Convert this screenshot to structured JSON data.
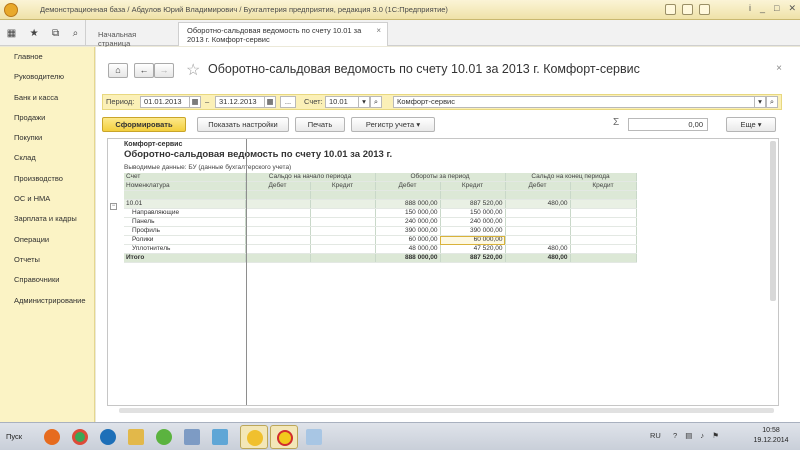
{
  "window": {
    "title": "Демонстрационная база / Абдулов Юрий Владимирович / Бухгалтерия предприятия, редакция 3.0 (1С:Предприятие)"
  },
  "tabs": {
    "home": "Начальная страница",
    "active": "Оборотно-сальдовая ведомость по счету 10.01 за 2013 г. Комфорт-сервис"
  },
  "sidebar": {
    "items": [
      {
        "label": "Главное"
      },
      {
        "label": "Руководителю"
      },
      {
        "label": "Банк и касса"
      },
      {
        "label": "Продажи"
      },
      {
        "label": "Покупки"
      },
      {
        "label": "Склад"
      },
      {
        "label": "Производство"
      },
      {
        "label": "ОС и НМА"
      },
      {
        "label": "Зарплата и кадры"
      },
      {
        "label": "Операции"
      },
      {
        "label": "Отчеты"
      },
      {
        "label": "Справочники"
      },
      {
        "label": "Администрирование"
      }
    ]
  },
  "header": {
    "title": "Оборотно-сальдовая ведомость по счету 10.01 за 2013 г. Комфорт-сервис",
    "nav_back": "←",
    "nav_forward": "→"
  },
  "filters": {
    "period_label": "Период:",
    "date_from": "01.01.2013",
    "dash": "–",
    "date_to": "31.12.2013",
    "choose_period": "...",
    "account_label": "Счет:",
    "account": "10.01",
    "organization": "Комфорт-сервис"
  },
  "toolbar": {
    "generate": "Сформировать",
    "show_settings": "Показать настройки",
    "print": "Печать",
    "account_register": "Регистр учета",
    "sum_value": "0,00",
    "more": "Еще"
  },
  "report": {
    "org": "Комфорт-сервис",
    "title": "Оборотно-сальдовая ведомость по счету 10.01 за 2013 г.",
    "source": "Выводимые данные:  БУ (данные бухгалтерского учета)",
    "col_account": "Счет",
    "col_nomenclature": "Номенклатура",
    "col_opening": "Сальдо на начало периода",
    "col_turnover": "Обороты за период",
    "col_closing": "Сальдо на конец периода",
    "col_debit": "Дебет",
    "col_credit": "Кредит",
    "account_row": {
      "name": "10.01",
      "turn_debit": "888 000,00",
      "turn_credit": "887 520,00",
      "close_debit": "480,00"
    },
    "rows": [
      {
        "name": "Направляющие",
        "turn_debit": "150 000,00",
        "turn_credit": "150 000,00",
        "close_debit": ""
      },
      {
        "name": "Панель",
        "turn_debit": "240 000,00",
        "turn_credit": "240 000,00",
        "close_debit": ""
      },
      {
        "name": "Профиль",
        "turn_debit": "390 000,00",
        "turn_credit": "390 000,00",
        "close_debit": ""
      },
      {
        "name": "Ролики",
        "turn_debit": "60 000,00",
        "turn_credit": "60 000,00",
        "close_debit": ""
      },
      {
        "name": "Уплотнитель",
        "turn_debit": "48 000,00",
        "turn_credit": "47 520,00",
        "close_debit": "480,00"
      }
    ],
    "total": {
      "name": "Итого",
      "turn_debit": "888 000,00",
      "turn_credit": "887 520,00",
      "close_debit": "480,00"
    }
  },
  "taskbar": {
    "start": "Пуск",
    "lang": "RU",
    "time": "10:58",
    "date": "19.12.2014"
  },
  "colors": {
    "sidebar_bg": "#fbf3c5",
    "primary_button": "#f3cf3e",
    "table_header": "#dce8d6"
  }
}
